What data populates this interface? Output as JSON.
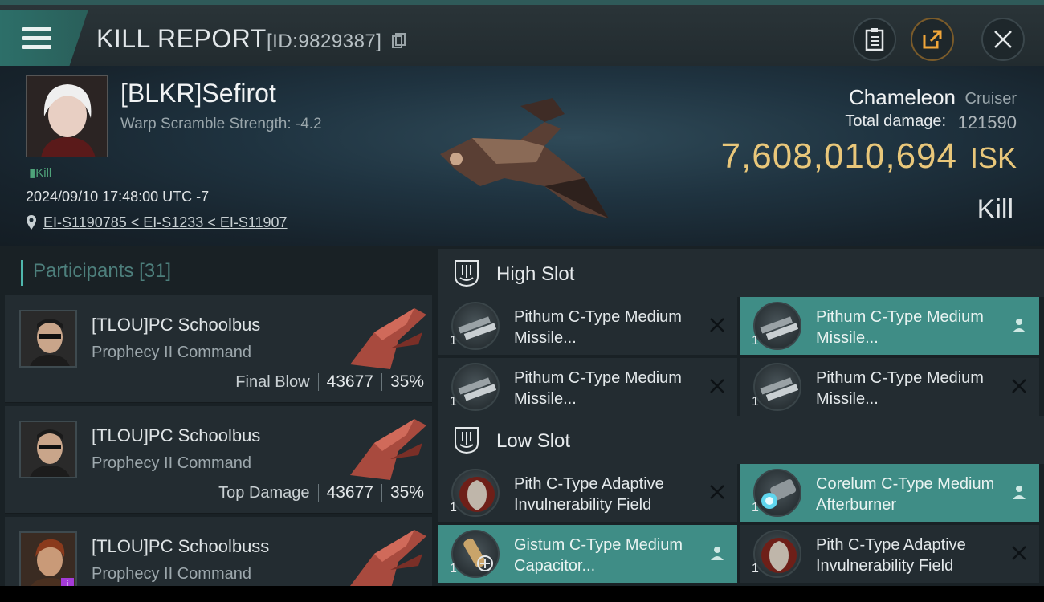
{
  "header": {
    "title": "KILL REPORT",
    "id_text": "[ID:9829387]"
  },
  "victim": {
    "name": "[BLKR]Sefirot",
    "warp_scramble": "Warp Scramble Strength: -4.2",
    "tag": "Kill",
    "datetime": "2024/09/10 17:48:00 UTC -7",
    "location": "EI-S1190785 < EI-S1233 < EI-S11907",
    "ship_name": "Chameleon",
    "ship_class": "Cruiser",
    "total_damage_label": "Total damage:",
    "total_damage": "121590",
    "isk_value": "7,608,010,694",
    "isk_unit": "ISK",
    "result": "Kill"
  },
  "participants": {
    "label": "Participants",
    "count": "[31]",
    "rows": [
      {
        "name": "[TLOU]PC Schoolbus",
        "ship": "Prophecy II Command",
        "role": "Final Blow",
        "damage": "43677",
        "percent": "35%"
      },
      {
        "name": "[TLOU]PC Schoolbus",
        "ship": "Prophecy II Command",
        "role": "Top Damage",
        "damage": "43677",
        "percent": "35%"
      },
      {
        "name": "[TLOU]PC Schoolbuss",
        "ship": "Prophecy II Command",
        "role": "",
        "damage": "",
        "percent": "",
        "badge": "i"
      }
    ]
  },
  "slots": {
    "high": {
      "title": "High Slot",
      "items": [
        {
          "name": "Pithum C-Type Medium Missile...",
          "qty": "1",
          "state": "destroyed"
        },
        {
          "name": "Pithum C-Type Medium Missile...",
          "qty": "1",
          "state": "dropped"
        },
        {
          "name": "Pithum C-Type Medium Missile...",
          "qty": "1",
          "state": "destroyed"
        },
        {
          "name": "Pithum C-Type Medium Missile...",
          "qty": "1",
          "state": "destroyed"
        }
      ]
    },
    "low": {
      "title": "Low Slot",
      "items": [
        {
          "name": "Pith C-Type Adaptive Invulnerability Field",
          "qty": "1",
          "state": "destroyed"
        },
        {
          "name": "Corelum C-Type Medium Afterburner",
          "qty": "1",
          "state": "dropped"
        },
        {
          "name": "Gistum C-Type Medium Capacitor...",
          "qty": "1",
          "state": "dropped"
        },
        {
          "name": "Pith C-Type Adaptive Invulnerability Field",
          "qty": "1",
          "state": "destroyed"
        }
      ]
    }
  },
  "colors": {
    "accent_teal": "#3f8d86",
    "isk_gold": "#e9c77a",
    "kill_green": "#4fa37a"
  }
}
